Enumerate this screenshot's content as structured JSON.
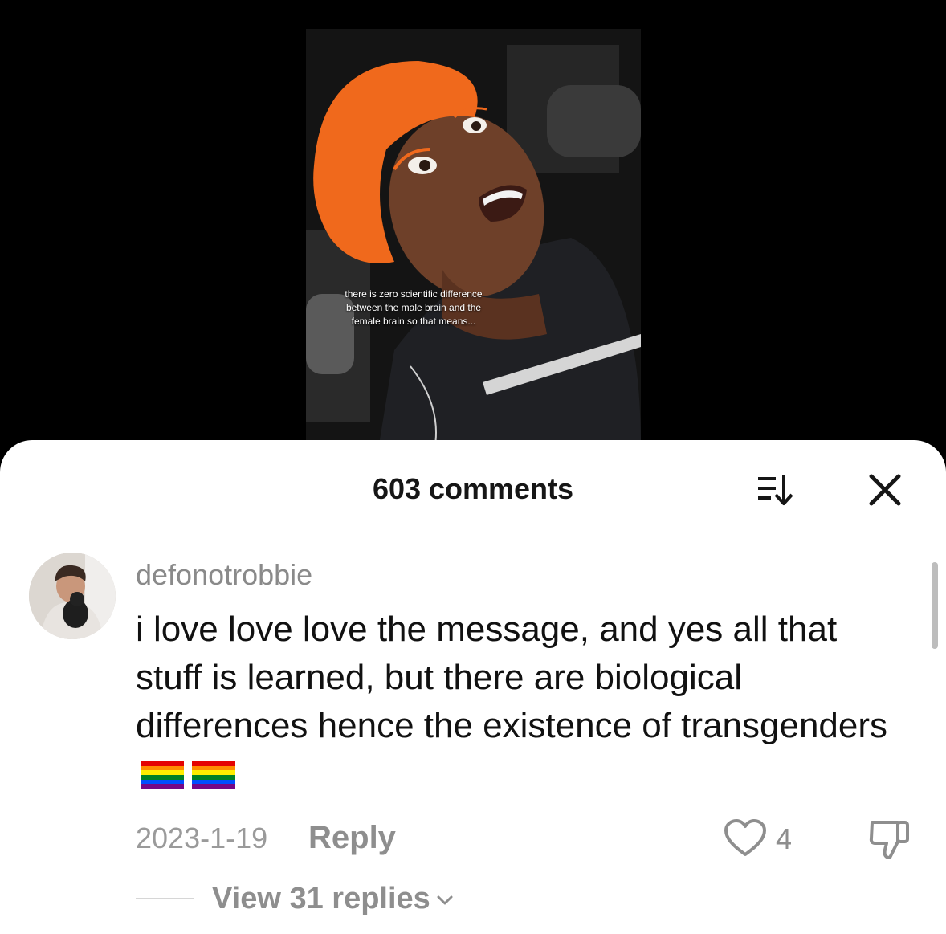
{
  "video": {
    "caption": "there is zero scientific difference between the male brain and the female brain so that means..."
  },
  "comments_panel": {
    "title": "603 comments",
    "sort_icon": "sort-icon",
    "close_icon": "close-icon"
  },
  "comment": {
    "username": "defonotrobbie",
    "text": "i love love love the message, and yes all that stuff is learned, but there are biological differences hence the existence of transgenders",
    "emoji": [
      "rainbow-flag",
      "rainbow-flag"
    ],
    "date": "2023-1-19",
    "reply_label": "Reply",
    "like_count": "4",
    "view_replies_label": "View 31 replies"
  },
  "colors": {
    "background": "#000000",
    "sheet": "#ffffff",
    "muted_text": "#8e8e8e",
    "text": "#111111",
    "beanie": "#f0691c"
  }
}
